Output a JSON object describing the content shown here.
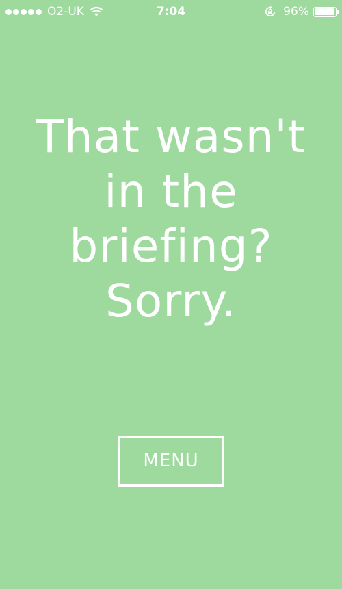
{
  "status_bar": {
    "carrier": "O2-UK",
    "time": "7:04",
    "battery_percent_label": "96%",
    "battery_level": 0.96,
    "signal_bars": 5,
    "icons": [
      "signal-dots",
      "wifi-icon",
      "rotation-lock-icon",
      "battery-icon"
    ]
  },
  "message": {
    "lines": [
      "That wasn't",
      "in the",
      "briefing?",
      "Sorry."
    ]
  },
  "menu_button": {
    "label": "MENU"
  },
  "colors": {
    "background": "#9ed99e",
    "foreground": "#ffffff"
  }
}
